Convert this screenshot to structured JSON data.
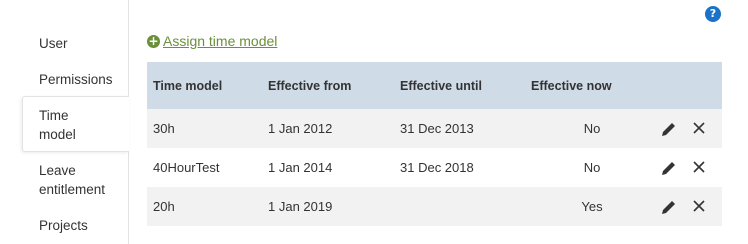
{
  "help_icon": "?",
  "sidebar": {
    "items": [
      {
        "label": "User"
      },
      {
        "label": "Permissions"
      },
      {
        "label": "Time model"
      },
      {
        "label": "Leave entitlement"
      },
      {
        "label": "Projects"
      }
    ]
  },
  "assign": {
    "icon": "+",
    "label": "Assign time model"
  },
  "table": {
    "headers": [
      "Time model",
      "Effective from",
      "Effective until",
      "Effective now"
    ],
    "rows": [
      {
        "model": "30h",
        "from": "1 Jan 2012",
        "until": "31 Dec 2013",
        "now": "No"
      },
      {
        "model": "40HourTest",
        "from": "1 Jan 2014",
        "until": "31 Dec 2018",
        "now": "No"
      },
      {
        "model": "20h",
        "from": "1 Jan 2019",
        "until": "",
        "now": "Yes"
      }
    ]
  },
  "colors": {
    "accent": "#6b8f3a",
    "header_bg": "#cfdbe6",
    "help": "#1a73c9"
  }
}
